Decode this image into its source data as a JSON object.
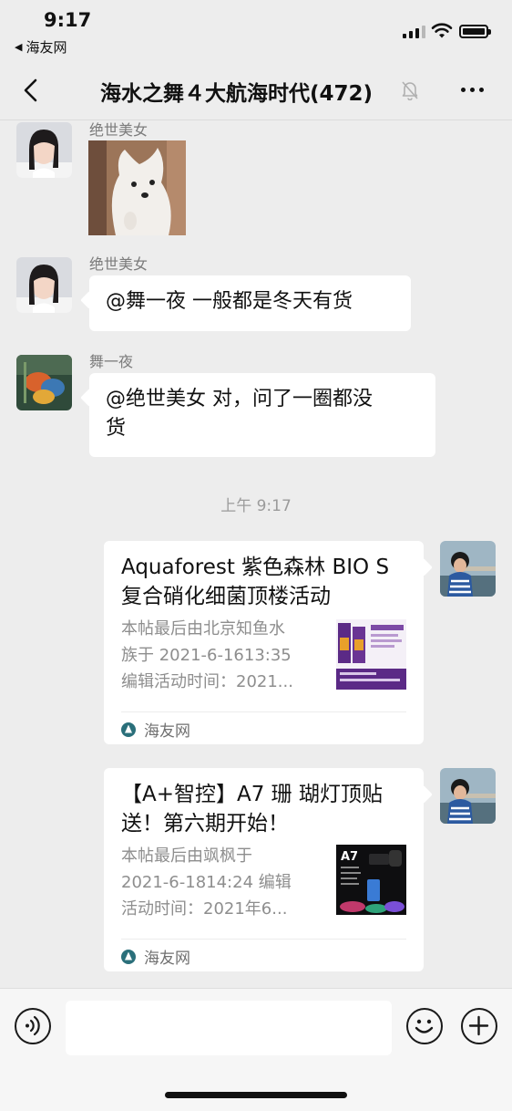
{
  "status_bar": {
    "time": "9:17",
    "back_app": "海友网",
    "back_arrow": "◀"
  },
  "nav": {
    "title": "海水之舞４大航海时代(472)",
    "back_icon": "chevron-left-icon",
    "mute_icon": "bell-slash-icon",
    "more_icon": "more-dots-icon"
  },
  "messages": [
    {
      "sender": "绝世美女",
      "type": "image",
      "image": "samoyed-puppy-photo"
    },
    {
      "sender": "绝世美女",
      "type": "text",
      "text": "@舞一夜 一般都是冬天有货"
    },
    {
      "sender": "舞一夜",
      "type": "text",
      "text_line1": "@绝世美女 对，问了一圈都没",
      "text_line2": "货"
    }
  ],
  "timestamp": "上午 9:17",
  "link_cards": [
    {
      "title_line1": "Aquaforest 紫色森林 BIO S",
      "title_line2": "复合硝化细菌顶楼活动",
      "desc_line1": "本帖最后由北京知鱼水",
      "desc_line2": "族于 2021-6-1613:35",
      "desc_line3": "编辑活动时间：2021...",
      "source": "海友网",
      "thumb_colors": [
        "#5b2a86",
        "#e8a02a"
      ]
    },
    {
      "title_line1": "【A+智控】A7 珊 瑚灯顶贴",
      "title_line2": "送！第六期开始！",
      "desc_line1": "本帖最后由飒枫于",
      "desc_line2": "2021-6-1814:24 编辑",
      "desc_line3": "活动时间：2021年6...",
      "source": "海友网",
      "thumb_label": "A7"
    }
  ],
  "input": {
    "voice_icon": "voice-icon",
    "emoji_icon": "emoji-icon",
    "add_icon": "plus-icon",
    "placeholder": ""
  },
  "colors": {
    "background": "#ededed",
    "bubble": "#ffffff",
    "secondary_text": "#8e8e8e"
  }
}
